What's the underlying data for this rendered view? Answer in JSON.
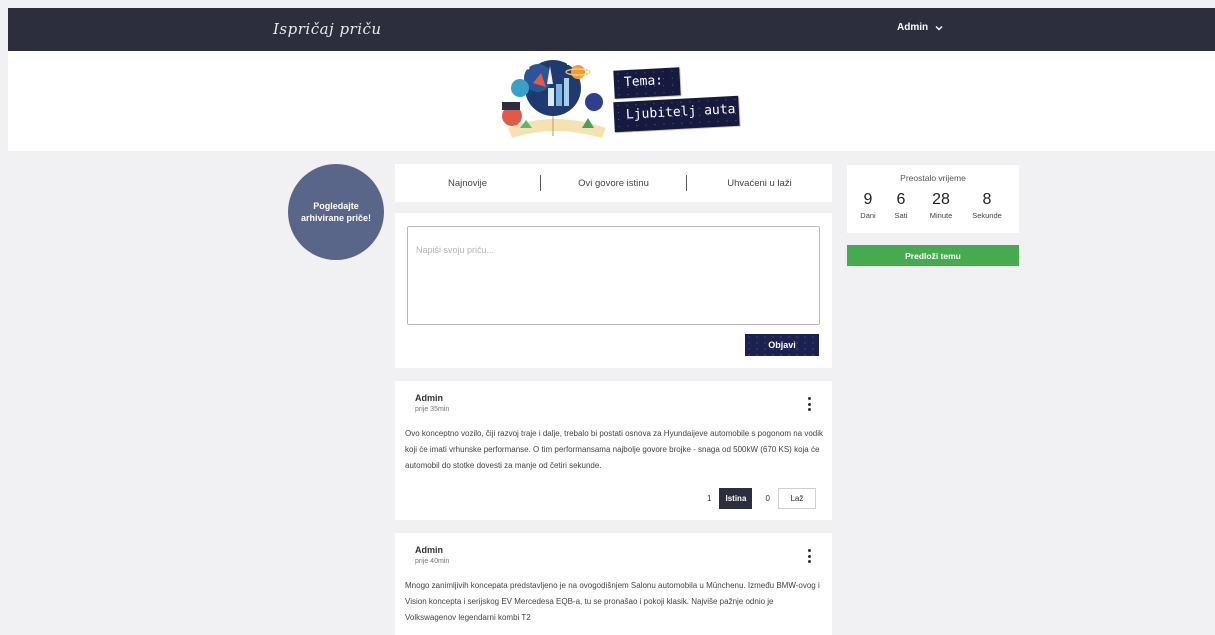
{
  "app": {
    "logo_text": "Ispričaj priču"
  },
  "header": {
    "user_label": "Admin"
  },
  "banner": {
    "theme_label": "Tema:",
    "theme_name": "Ljubitelj auta"
  },
  "sidebar_left": {
    "archive_button": "Pogledajte arhivirane priče!"
  },
  "tabs": [
    "Najnovije",
    "Ovi govore istinu",
    "Uhvaćeni u laži"
  ],
  "compose": {
    "placeholder": "Napiši svoju priču...",
    "submit_label": "Objavi"
  },
  "posts": [
    {
      "author": "Admin",
      "time": "prije 35min",
      "text": "Ovo konceptno vozilo, čiji razvoj traje i dalje, trebalo bi postati osnova za Hyundaijeve automobile s pogonom na vodik koji će imati vrhunske performanse. O tim performansama najbolje govore brojke - snaga od 500kW (670 KS) koja će automobil do stotke dovesti za manje od četiri sekunde.",
      "true_count": "1",
      "true_label": "Istina",
      "false_count": "0",
      "false_label": "Laž"
    },
    {
      "author": "Admin",
      "time": "prije 40min",
      "text": "Mnogo zanimljivih koncepata predstavljeno je na ovogodišnjem Salonu automobila u Münchenu. Između BMW-ovog i Vision koncepta i serijskog EV Mercedesa EQB-a, tu se pronašao i pokoji klasik. Najviše pažnje odnio je Volkswagenov legendarni kombi T2"
    }
  ],
  "timer": {
    "title": "Preostalo vrijeme",
    "units": [
      {
        "value": "9",
        "label": "Dani"
      },
      {
        "value": "6",
        "label": "Sati"
      },
      {
        "value": "28",
        "label": "Minute"
      },
      {
        "value": "8",
        "label": "Sekunde"
      }
    ]
  },
  "suggest_button": "Predloži temu",
  "colors": {
    "nav": "#2c2e3d",
    "archive": "#5a6689",
    "accent_green": "#46aa4e",
    "button_dark": "#1b2150"
  }
}
